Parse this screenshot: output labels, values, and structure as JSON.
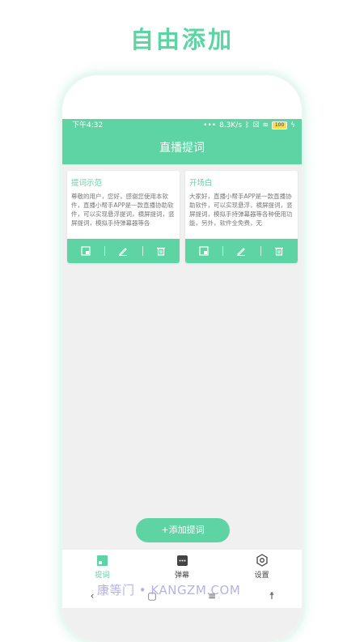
{
  "headline": "自由添加",
  "status": {
    "time": "下午4:32",
    "speed": "8.3K/s",
    "battery": "100"
  },
  "appbar": {
    "title": "直播提词"
  },
  "cards": [
    {
      "title": "提词示范",
      "body": "尊敬的用户，您好，感谢您使用本软件，直播小帮手APP是一款直播协助软件，可以实现悬浮提词，横屏提词，竖屏提词，模拟手持弹幕器等各"
    },
    {
      "title": "开场白",
      "body": "大家好，直播小帮手APP是一款直播协助软件，可以实现悬浮，横屏提词，竖屏提词，模拟手持弹幕器等各种使用功能，另外，软件全免费，无"
    }
  ],
  "add_button": "+添加提词",
  "tabs": [
    {
      "label": "提词",
      "icon": "note-icon"
    },
    {
      "label": "弹幕",
      "icon": "chat-icon"
    },
    {
      "label": "设置",
      "icon": "settings-icon"
    }
  ],
  "watermark": "康等门 • KANGZM.COM",
  "colors": {
    "accent": "#5ed4a4"
  }
}
